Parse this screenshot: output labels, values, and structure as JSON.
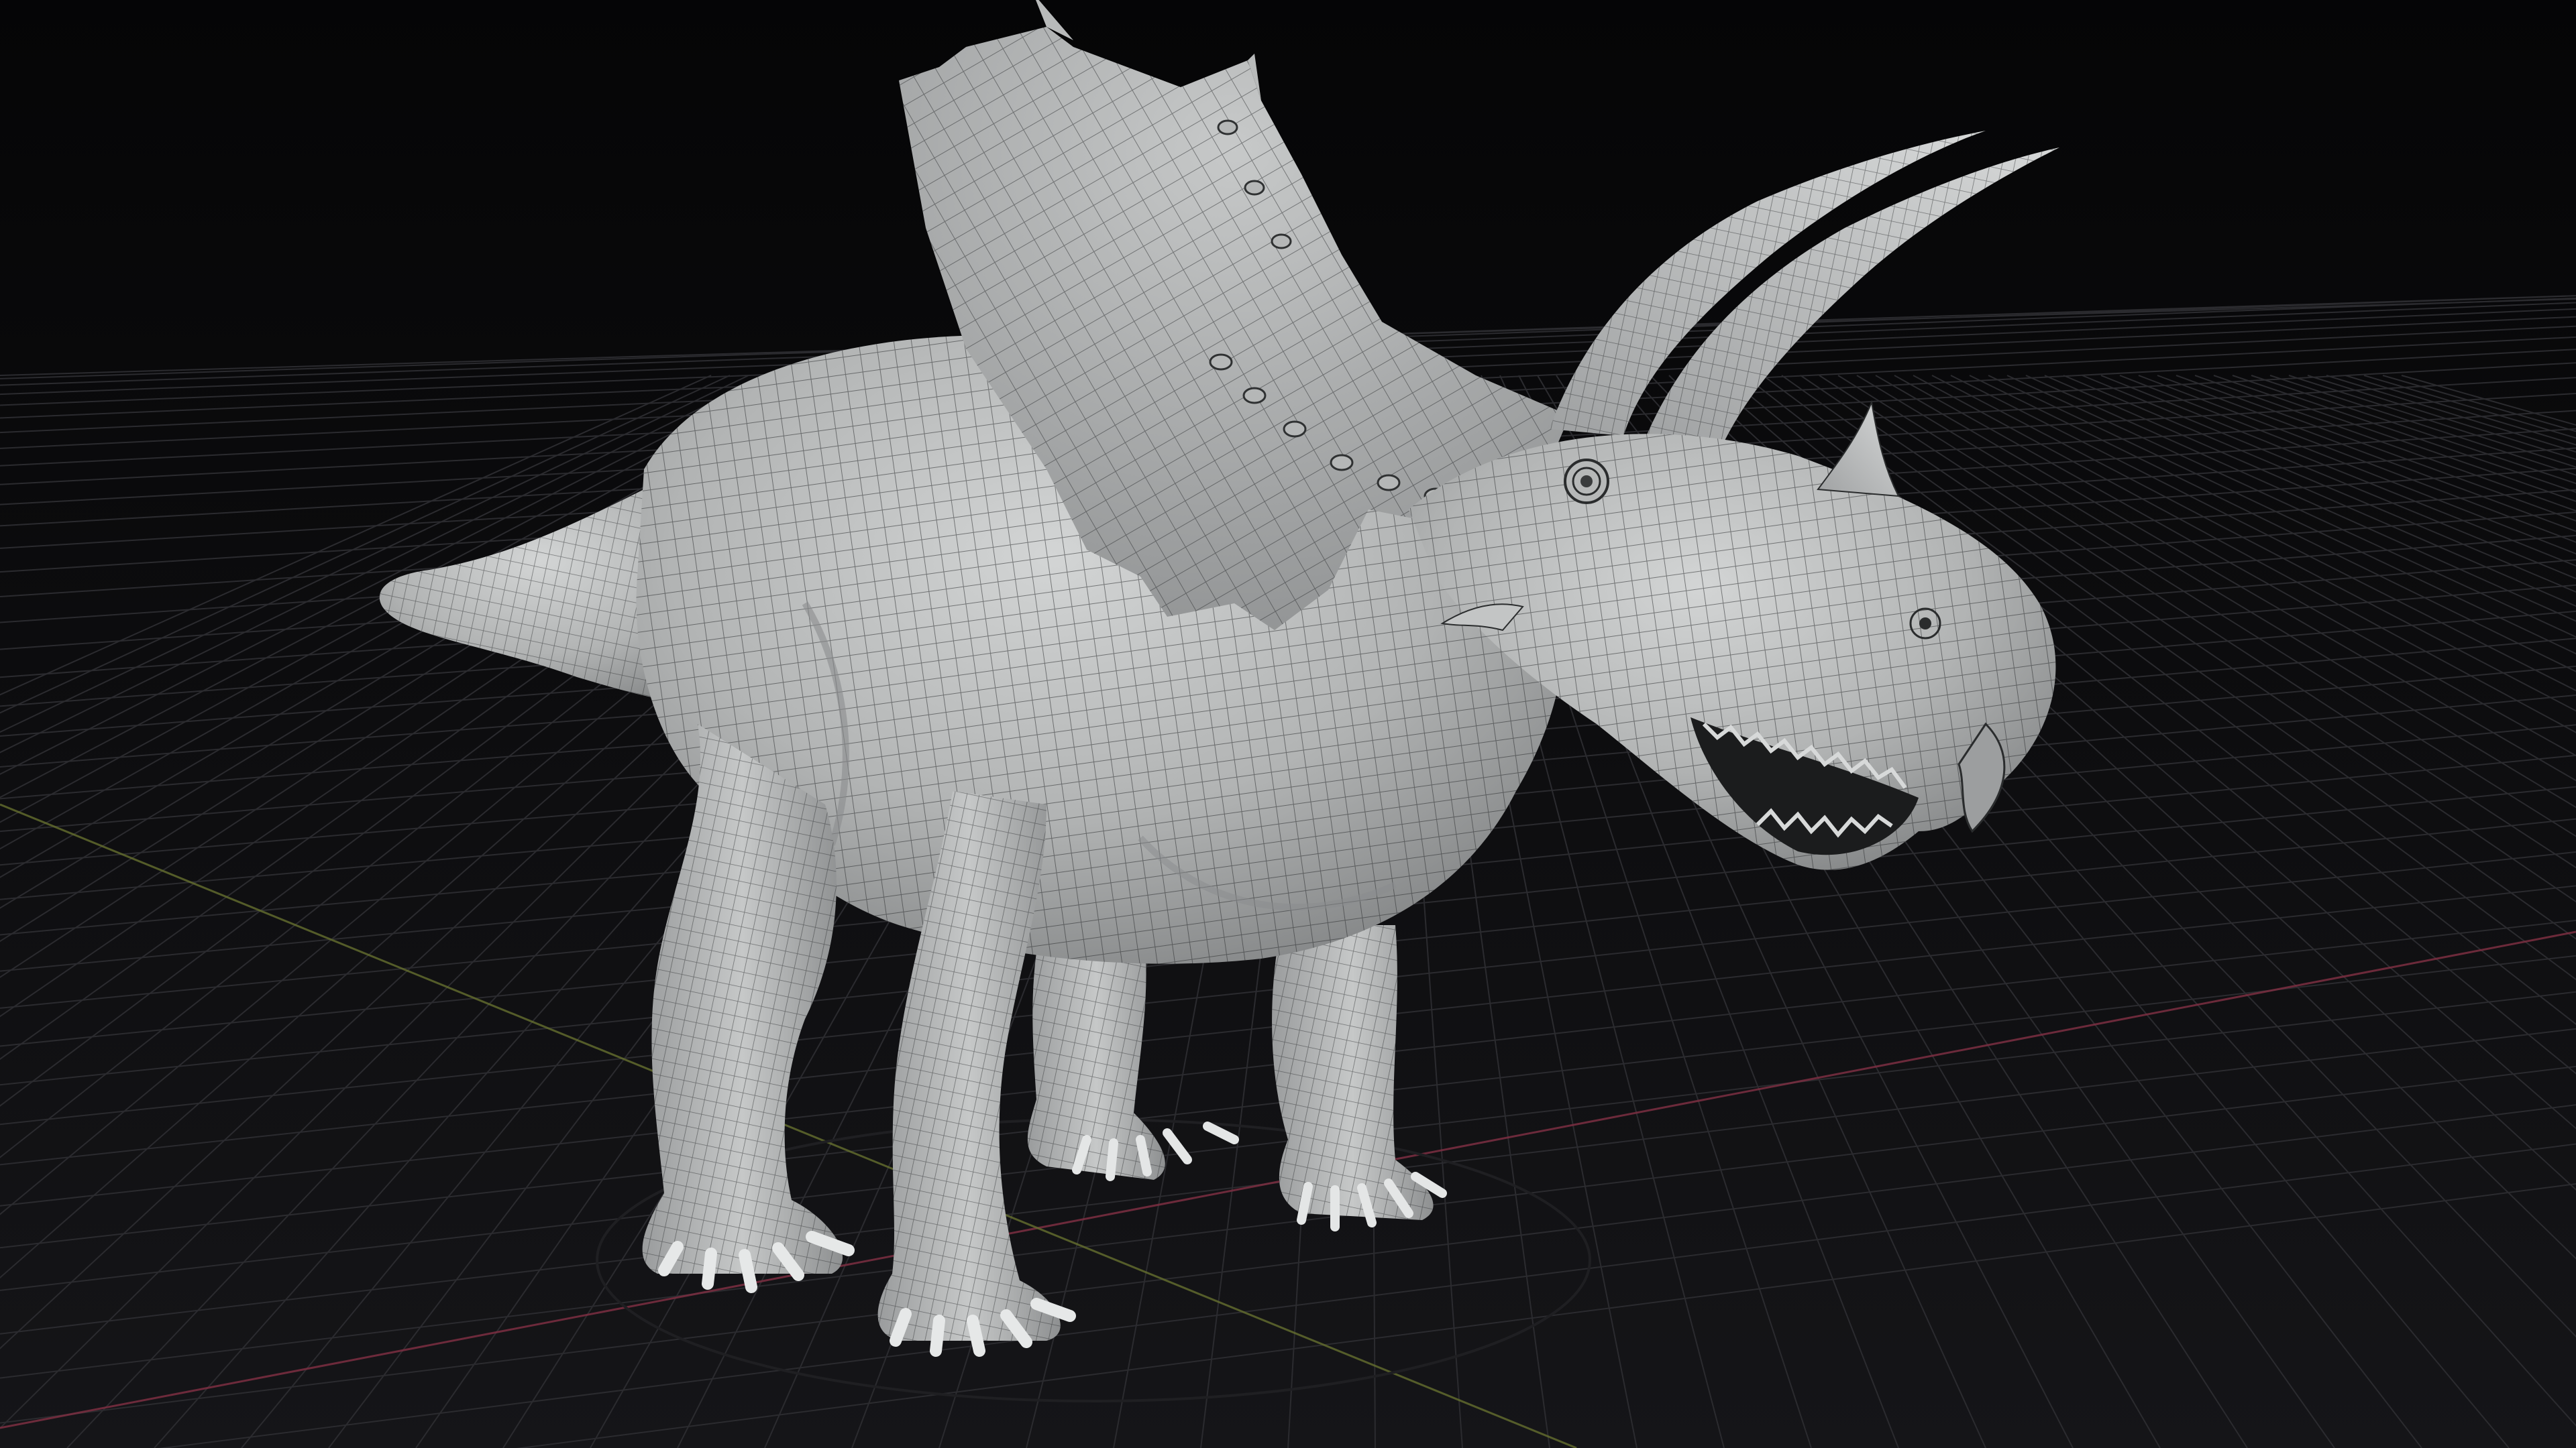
{
  "viewport": {
    "mode": "3d-perspective",
    "shading": "solid-wireframe-overlay",
    "grid_visible": true,
    "colors": {
      "background_top": "#050506",
      "background_bottom": "#141417",
      "grid_line": "#2b2b2f",
      "axis_x": "#8a3346",
      "axis_y": "#6d7434",
      "mesh_light": "#c9cbcb",
      "mesh_mid": "#a9abab",
      "mesh_shadow": "#7c7e7f",
      "wire": "#2a2c2d"
    }
  },
  "scene": {
    "object_name": "triceratops-mesh",
    "ground_gizmo_visible": true
  }
}
